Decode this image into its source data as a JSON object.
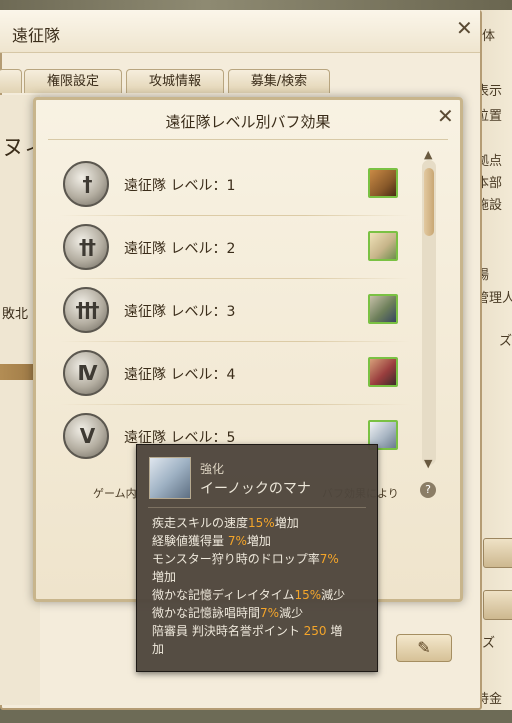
{
  "main_window": {
    "title": "遠征隊",
    "tabs": [
      "権限設定",
      "攻城情報",
      "募集/検索"
    ],
    "left_partial_texts": [
      "ヌィ",
      "敗北"
    ],
    "edit_icon": "pencil-icon"
  },
  "right_panel": {
    "items": [
      "体",
      "表示",
      "位置",
      "拠点",
      "本部",
      "施設",
      "場",
      "管理人",
      "ズ",
      "ズ",
      "持金"
    ]
  },
  "buff_popup": {
    "title": "遠征隊レベル別バフ効果",
    "rows": [
      {
        "label": "遠征隊 レベル：1",
        "emblem_icon": "sword-1-emblem-icon",
        "emblem_glyph": "†",
        "portrait_color": "#8a5a2a"
      },
      {
        "label": "遠征隊 レベル：2",
        "emblem_icon": "sword-2-emblem-icon",
        "emblem_glyph": "††",
        "portrait_color": "#c7b58a"
      },
      {
        "label": "遠征隊 レベル：3",
        "emblem_icon": "sword-3-emblem-icon",
        "emblem_glyph": "†††",
        "portrait_color": "#6d7f5a"
      },
      {
        "label": "遠征隊 レベル：4",
        "emblem_icon": "sword-4-emblem-icon",
        "emblem_glyph": "IV",
        "portrait_color": "#9a3e3e"
      },
      {
        "label": "遠征隊 レベル：5",
        "emblem_icon": "sword-5-emblem-icon",
        "emblem_glyph": "V",
        "portrait_color": "#aab7c4"
      }
    ],
    "footer_left": "ゲーム内",
    "footer_right": "バフ効果により",
    "help_label": "?"
  },
  "tooltip": {
    "category": "強化",
    "name": "イーノックのマナ",
    "lines": [
      [
        {
          "t": "疾走スキルの速度"
        },
        {
          "t": "15%",
          "hl": true
        },
        {
          "t": "増加"
        }
      ],
      [
        {
          "t": "経験値獲得量 "
        },
        {
          "t": "7%",
          "hl": true
        },
        {
          "t": "増加"
        }
      ],
      [
        {
          "t": "モンスター狩り時のドロップ率"
        },
        {
          "t": "7%",
          "hl": true
        }
      ],
      [
        {
          "t": "増加"
        }
      ],
      [
        {
          "t": "微かな記憶ディレイタイム"
        },
        {
          "t": "15%",
          "hl": true
        },
        {
          "t": "減少"
        }
      ],
      [
        {
          "t": "微かな記憶詠唱時間"
        },
        {
          "t": "7%",
          "hl": true
        },
        {
          "t": "減少"
        }
      ],
      [
        {
          "t": "陪審員 判決時名誉ポイント "
        },
        {
          "t": "250",
          "hl": true
        },
        {
          "t": " 増"
        }
      ],
      [
        {
          "t": "加"
        }
      ]
    ]
  },
  "colors": {
    "highlight": "#f4a52a",
    "portrait_border": "#7ac143"
  }
}
